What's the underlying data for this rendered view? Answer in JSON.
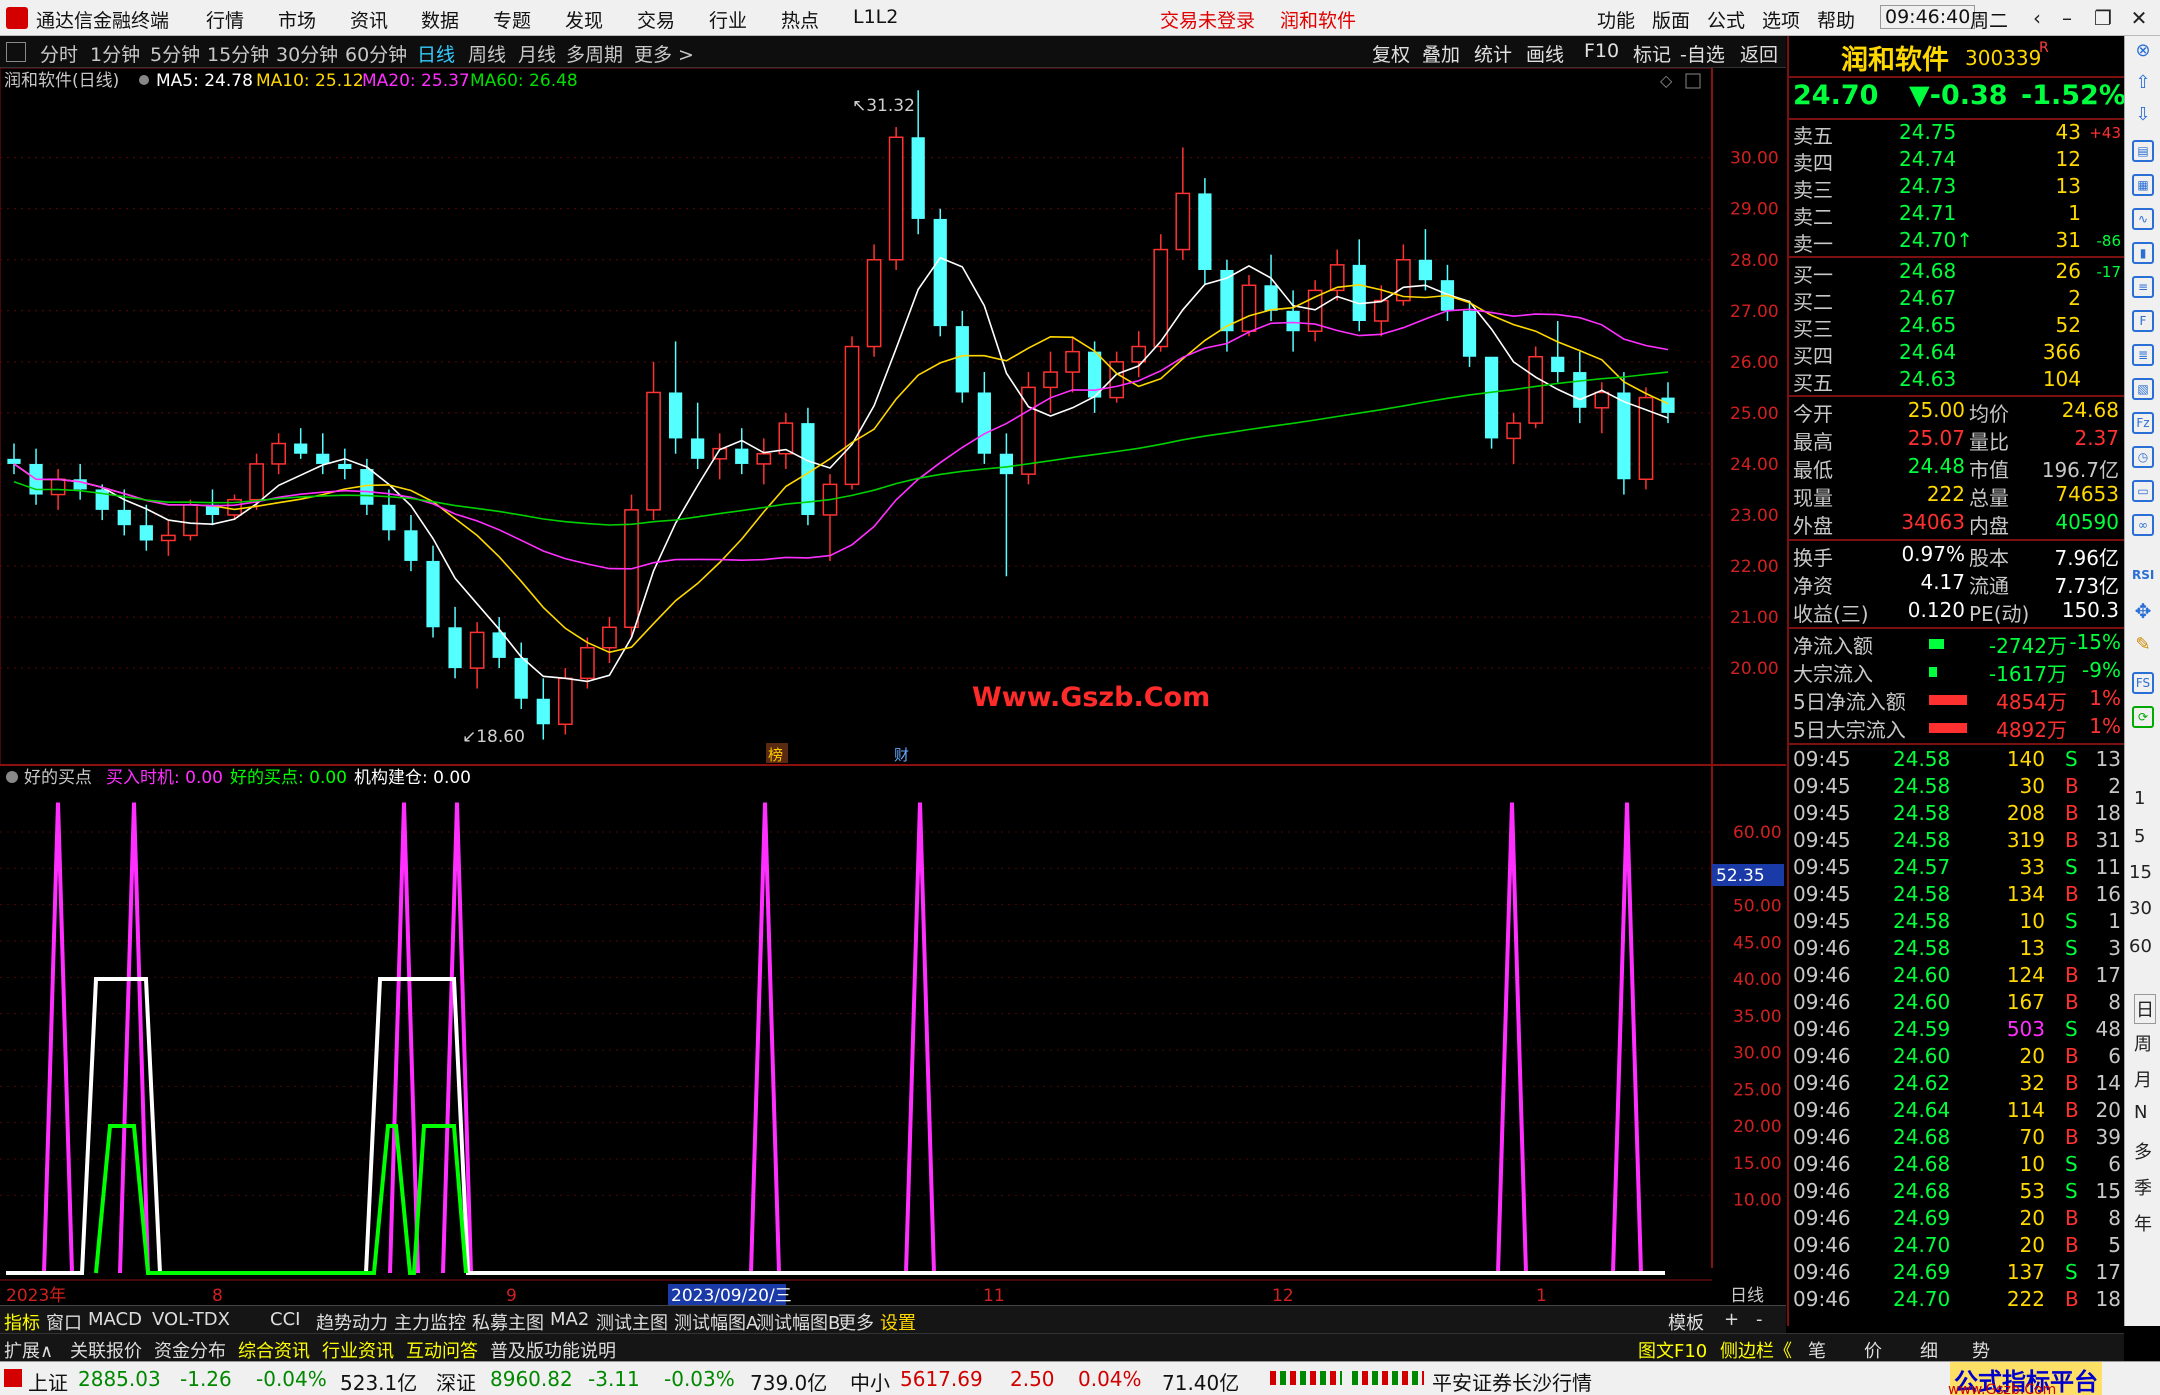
{
  "app": {
    "title": "通达信金融终端",
    "login": "交易未登录",
    "stock_header": "润和软件",
    "time": "09:46:40",
    "weekday": "周二"
  },
  "menu": [
    "行情",
    "市场",
    "资讯",
    "数据",
    "专题",
    "发现",
    "交易",
    "行业",
    "热点",
    "L1L2"
  ],
  "menu_right": [
    "功能",
    "版面",
    "公式",
    "选项",
    "帮助"
  ],
  "periods": [
    "分时",
    "1分钟",
    "5分钟",
    "15分钟",
    "30分钟",
    "60分钟",
    "日线",
    "周线",
    "月线",
    "多周期",
    "更多 >"
  ],
  "tools": [
    "复权",
    "叠加",
    "统计",
    "画线",
    "F10",
    "标记",
    "-自选",
    "返回"
  ],
  "main_chart": {
    "label": "润和软件(日线)",
    "ma": [
      {
        "name": "MA5: 24.78",
        "color": "#ffffff"
      },
      {
        "name": "MA10: 25.12",
        "color": "#ffd800"
      },
      {
        "name": "MA20: 25.37",
        "color": "#ff30ff"
      },
      {
        "name": "MA60: 26.48",
        "color": "#00e000"
      }
    ],
    "high_label": "31.32",
    "low_label": "18.60",
    "y_ticks": [
      "30.00",
      "29.00",
      "28.00",
      "27.00",
      "26.00",
      "25.00",
      "24.00",
      "23.00",
      "22.00",
      "21.00",
      "20.00"
    ],
    "watermark": "Www.Gszb.Com",
    "markers": [
      "榜",
      "财"
    ]
  },
  "sub_chart": {
    "label": "好的买点",
    "params": [
      {
        "name": "买入时机: 0.00",
        "color": "#ff30ff"
      },
      {
        "name": "好的买点: 0.00",
        "color": "#00ff00"
      },
      {
        "name": "机构建仓: 0.00",
        "color": "#ffffff"
      }
    ],
    "y_ticks": [
      "60.00",
      "55.00",
      "50.00",
      "45.00",
      "40.00",
      "35.00",
      "30.00",
      "25.00",
      "20.00",
      "15.00",
      "10.00"
    ],
    "cursor_value": "52.35"
  },
  "x_axis": {
    "labels": [
      "2023年",
      "8",
      "9",
      "2023/09/20/三",
      "11",
      "12",
      "1"
    ],
    "right": "日线"
  },
  "chart_data": {
    "type": "candlestick",
    "title": "润和软件(日线)",
    "ylim": [
      18.2,
      31.6
    ],
    "ohlc": [
      [
        24.1,
        24.4,
        23.8,
        24.0
      ],
      [
        24.0,
        24.3,
        23.2,
        23.4
      ],
      [
        23.4,
        23.9,
        23.1,
        23.7
      ],
      [
        23.7,
        24.0,
        23.3,
        23.5
      ],
      [
        23.5,
        23.6,
        22.9,
        23.1
      ],
      [
        23.1,
        23.5,
        22.6,
        22.8
      ],
      [
        22.8,
        23.2,
        22.3,
        22.5
      ],
      [
        22.5,
        22.9,
        22.2,
        22.6
      ],
      [
        22.6,
        23.3,
        22.5,
        23.2
      ],
      [
        23.2,
        23.5,
        22.8,
        23.0
      ],
      [
        23.0,
        23.4,
        22.9,
        23.3
      ],
      [
        23.3,
        24.2,
        23.1,
        24.0
      ],
      [
        24.0,
        24.6,
        23.8,
        24.4
      ],
      [
        24.4,
        24.7,
        24.1,
        24.2
      ],
      [
        24.2,
        24.6,
        23.8,
        24.0
      ],
      [
        24.0,
        24.3,
        23.7,
        23.9
      ],
      [
        23.9,
        24.1,
        23.0,
        23.2
      ],
      [
        23.2,
        23.5,
        22.5,
        22.7
      ],
      [
        22.7,
        23.0,
        21.9,
        22.1
      ],
      [
        22.1,
        22.4,
        20.6,
        20.8
      ],
      [
        20.8,
        21.2,
        19.8,
        20.0
      ],
      [
        20.0,
        20.9,
        19.6,
        20.7
      ],
      [
        20.7,
        21.0,
        20.0,
        20.2
      ],
      [
        20.2,
        20.5,
        19.2,
        19.4
      ],
      [
        19.4,
        19.8,
        18.6,
        18.9
      ],
      [
        18.9,
        20.0,
        18.7,
        19.8
      ],
      [
        19.8,
        20.6,
        19.6,
        20.4
      ],
      [
        20.4,
        21.0,
        20.1,
        20.8
      ],
      [
        20.8,
        23.4,
        20.6,
        23.1
      ],
      [
        23.1,
        26.0,
        22.9,
        25.4
      ],
      [
        25.4,
        26.4,
        24.2,
        24.5
      ],
      [
        24.5,
        25.2,
        23.9,
        24.1
      ],
      [
        24.1,
        24.6,
        23.7,
        24.3
      ],
      [
        24.3,
        24.7,
        23.8,
        24.0
      ],
      [
        24.0,
        24.5,
        23.6,
        24.2
      ],
      [
        24.2,
        25.0,
        23.9,
        24.8
      ],
      [
        24.8,
        25.1,
        22.8,
        23.0
      ],
      [
        23.0,
        23.8,
        22.1,
        23.6
      ],
      [
        23.6,
        26.5,
        23.5,
        26.3
      ],
      [
        26.3,
        28.3,
        26.1,
        28.0
      ],
      [
        28.0,
        30.6,
        27.8,
        30.4
      ],
      [
        30.4,
        31.32,
        28.5,
        28.8
      ],
      [
        28.8,
        29.0,
        26.5,
        26.7
      ],
      [
        26.7,
        27.0,
        25.2,
        25.4
      ],
      [
        25.4,
        25.8,
        24.0,
        24.2
      ],
      [
        24.2,
        24.6,
        21.8,
        23.8
      ],
      [
        23.8,
        25.8,
        23.6,
        25.5
      ],
      [
        25.5,
        26.2,
        25.0,
        25.8
      ],
      [
        25.8,
        26.5,
        25.4,
        26.2
      ],
      [
        26.2,
        26.4,
        25.0,
        25.3
      ],
      [
        25.3,
        26.2,
        25.2,
        26.0
      ],
      [
        26.0,
        26.6,
        25.7,
        26.3
      ],
      [
        26.3,
        28.5,
        26.2,
        28.2
      ],
      [
        28.2,
        30.2,
        28.0,
        29.3
      ],
      [
        29.3,
        29.6,
        27.5,
        27.8
      ],
      [
        27.8,
        28.0,
        26.2,
        26.6
      ],
      [
        26.6,
        27.7,
        26.5,
        27.5
      ],
      [
        27.5,
        28.1,
        26.8,
        27.0
      ],
      [
        27.0,
        27.4,
        26.2,
        26.6
      ],
      [
        26.6,
        27.6,
        26.4,
        27.4
      ],
      [
        27.4,
        28.2,
        27.2,
        27.9
      ],
      [
        27.9,
        28.4,
        26.6,
        26.8
      ],
      [
        26.8,
        27.5,
        26.5,
        27.2
      ],
      [
        27.2,
        28.3,
        27.1,
        28.0
      ],
      [
        28.0,
        28.6,
        27.4,
        27.6
      ],
      [
        27.6,
        27.9,
        26.8,
        27.0
      ],
      [
        27.0,
        27.2,
        25.9,
        26.1
      ],
      [
        26.1,
        25.7,
        24.3,
        24.5
      ],
      [
        24.5,
        25.0,
        24.0,
        24.8
      ],
      [
        24.8,
        26.3,
        24.7,
        26.1
      ],
      [
        26.1,
        26.8,
        25.6,
        25.8
      ],
      [
        25.8,
        26.2,
        24.8,
        25.1
      ],
      [
        25.1,
        25.6,
        24.6,
        25.4
      ],
      [
        25.4,
        25.8,
        23.4,
        23.7
      ],
      [
        23.7,
        25.5,
        23.5,
        25.3
      ],
      [
        25.3,
        25.6,
        24.8,
        25.0
      ]
    ],
    "ma_series": [
      "MA5",
      "MA10",
      "MA20",
      "MA60"
    ]
  },
  "quote": {
    "name": "润和软件",
    "code": "300339",
    "flag": "R",
    "price": "24.70",
    "change": "▼-0.38",
    "pct": "-1.52%",
    "asks": [
      {
        "label": "卖五",
        "price": "24.75",
        "vol": "43",
        "chg": "+43"
      },
      {
        "label": "卖四",
        "price": "24.74",
        "vol": "12",
        "chg": ""
      },
      {
        "label": "卖三",
        "price": "24.73",
        "vol": "13",
        "chg": ""
      },
      {
        "label": "卖二",
        "price": "24.71",
        "vol": "1",
        "chg": ""
      },
      {
        "label": "卖一",
        "price": "24.70↑",
        "vol": "31",
        "chg": "-86"
      }
    ],
    "bids": [
      {
        "label": "买一",
        "price": "24.68",
        "vol": "26",
        "chg": "-17"
      },
      {
        "label": "买二",
        "price": "24.67",
        "vol": "2",
        "chg": ""
      },
      {
        "label": "买三",
        "price": "24.65",
        "vol": "52",
        "chg": ""
      },
      {
        "label": "买四",
        "price": "24.64",
        "vol": "366",
        "chg": ""
      },
      {
        "label": "买五",
        "price": "24.63",
        "vol": "104",
        "chg": ""
      }
    ],
    "stats": [
      [
        "今开",
        "25.00",
        "均价",
        "24.68"
      ],
      [
        "最高",
        "25.07",
        "量比",
        "2.37"
      ],
      [
        "最低",
        "24.48",
        "市值",
        "196.7亿"
      ],
      [
        "现量",
        "222",
        "总量",
        "74653"
      ],
      [
        "外盘",
        "34063",
        "内盘",
        "40590"
      ]
    ],
    "fund": [
      [
        "换手",
        "0.97%",
        "股本",
        "7.96亿"
      ],
      [
        "净资",
        "4.17",
        "流通",
        "7.73亿"
      ],
      [
        "收益(三)",
        "0.120",
        "PE(动)",
        "150.3"
      ]
    ],
    "flows": [
      {
        "label": "净流入额",
        "value": "-2742万",
        "pct": "-15%",
        "bar": 0.1
      },
      {
        "label": "大宗流入",
        "value": "-1617万",
        "pct": "-9%",
        "bar": 0.05
      },
      {
        "label": "5日净流入额",
        "value": "4854万",
        "pct": "1%",
        "bar": 0.25
      },
      {
        "label": "5日大宗流入",
        "value": "4892万",
        "pct": "1%",
        "bar": 0.25
      }
    ],
    "ticks": [
      [
        "09:45",
        "24.58",
        "140",
        "S",
        "13"
      ],
      [
        "09:45",
        "24.58",
        "30",
        "B",
        "2"
      ],
      [
        "09:45",
        "24.58",
        "208",
        "B",
        "18"
      ],
      [
        "09:45",
        "24.58",
        "319",
        "B",
        "31"
      ],
      [
        "09:45",
        "24.57",
        "33",
        "S",
        "11"
      ],
      [
        "09:45",
        "24.58",
        "134",
        "B",
        "16"
      ],
      [
        "09:45",
        "24.58",
        "10",
        "S",
        "1"
      ],
      [
        "09:46",
        "24.58",
        "13",
        "S",
        "3"
      ],
      [
        "09:46",
        "24.60",
        "124",
        "B",
        "17"
      ],
      [
        "09:46",
        "24.60",
        "167",
        "B",
        "8"
      ],
      [
        "09:46",
        "24.59",
        "503",
        "S",
        "48"
      ],
      [
        "09:46",
        "24.60",
        "20",
        "B",
        "6"
      ],
      [
        "09:46",
        "24.62",
        "32",
        "B",
        "14"
      ],
      [
        "09:46",
        "24.64",
        "114",
        "B",
        "20"
      ],
      [
        "09:46",
        "24.68",
        "70",
        "B",
        "39"
      ],
      [
        "09:46",
        "24.68",
        "10",
        "S",
        "6"
      ],
      [
        "09:46",
        "24.68",
        "53",
        "S",
        "15"
      ],
      [
        "09:46",
        "24.69",
        "20",
        "B",
        "8"
      ],
      [
        "09:46",
        "24.70",
        "20",
        "B",
        "5"
      ],
      [
        "09:46",
        "24.69",
        "137",
        "S",
        "17"
      ],
      [
        "09:46",
        "24.70",
        "222",
        "B",
        "18"
      ]
    ]
  },
  "side_strip": [
    "日",
    "周",
    "月",
    "N",
    "多",
    "季",
    "年"
  ],
  "side_nums": [
    "1",
    "5",
    "15",
    "30",
    "60"
  ],
  "tabs1": [
    "指标",
    "窗口",
    "MACD",
    "VOL-TDX",
    "CCI",
    "趋势动力",
    "主力监控",
    "私募主图",
    "MA2",
    "测试主图",
    "测试幅图A",
    "测试幅图B",
    "更多",
    "设置"
  ],
  "tabs1_right": [
    "模板",
    "+",
    "-"
  ],
  "tabs2": [
    "扩展∧",
    "关联报价",
    "资金分布",
    "综合资讯",
    "行业资讯",
    "互动问答",
    "普及版功能说明"
  ],
  "tabs2_right": [
    "图文F10",
    "侧边栏《",
    "笔",
    "价",
    "细",
    "势"
  ],
  "status": [
    {
      "name": "上证",
      "val": "2885.03",
      "chg": "-1.26",
      "pct": "-0.04%",
      "amt": "523.1亿"
    },
    {
      "name": "深证",
      "val": "8960.82",
      "chg": "-3.11",
      "pct": "-0.03%",
      "amt": "739.0亿"
    },
    {
      "name": "中小",
      "val": "5617.69",
      "chg": "2.50",
      "pct": "0.04%",
      "amt": "71.40亿"
    }
  ],
  "status_right": "平安证券长沙行情",
  "footer_logo": "公式指标平台",
  "footer_site": "www.Gszb.Com"
}
